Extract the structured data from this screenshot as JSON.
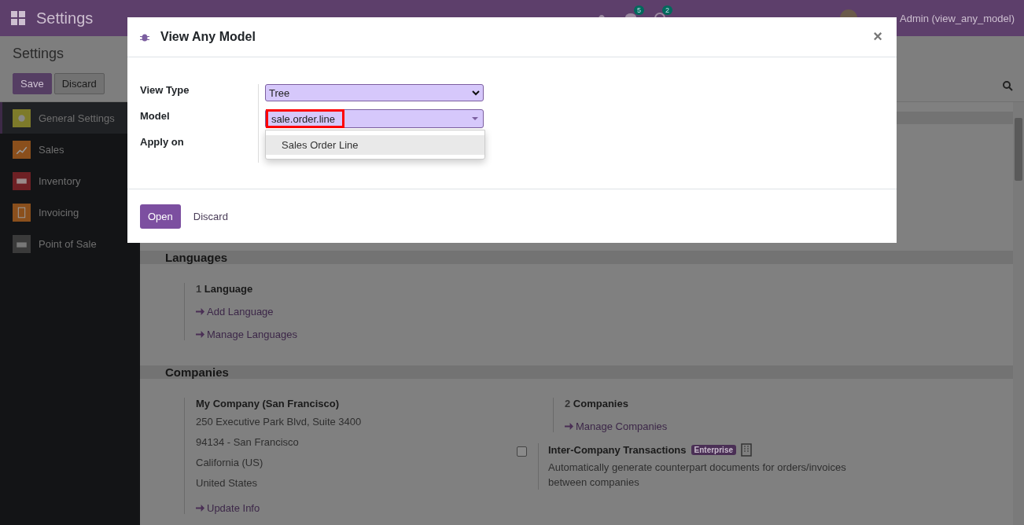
{
  "navbar": {
    "app_title": "Settings",
    "messages_count": "5",
    "activities_count": "2",
    "user": "Admin (view_any_model)"
  },
  "control_panel": {
    "title": "Settings",
    "buttons": [
      {
        "label": "Save",
        "kind": "primary"
      },
      {
        "label": "Discard",
        "kind": "secondary"
      }
    ]
  },
  "sidebar": {
    "items": [
      {
        "label": "General Settings",
        "selected": true,
        "color": "#7d7a2a"
      },
      {
        "label": "Sales",
        "selected": false,
        "color": "#8a4f1c"
      },
      {
        "label": "Inventory",
        "selected": false,
        "color": "#6e2024"
      },
      {
        "label": "Invoicing",
        "selected": false,
        "color": "#8a4f1c"
      },
      {
        "label": "Point of Sale",
        "selected": false,
        "color": "#3a3a3a"
      }
    ]
  },
  "sections": [
    {
      "title": "Languages",
      "left": {
        "heading_count": "1",
        "heading": "Language",
        "links": [
          "Add Language",
          "Manage Languages"
        ]
      }
    },
    {
      "title": "Companies",
      "left": {
        "heading": "My Company (San Francisco)",
        "lines": [
          "250 Executive Park Blvd, Suite 3400",
          "94134 - San Francisco",
          "California (US)",
          "United States"
        ],
        "links": [
          "Update Info"
        ]
      },
      "right": {
        "heading_count": "2",
        "heading": "Companies",
        "links": [
          "Manage Companies"
        ],
        "setting": {
          "label": "Inter-Company Transactions",
          "badge": "Enterprise",
          "checked": false,
          "description": "Automatically generate counterpart documents for orders/invoices between companies"
        }
      }
    }
  ],
  "dialog": {
    "title": "View Any Model",
    "close": "×",
    "fields": [
      {
        "label": "View Type",
        "kind": "select",
        "value": "Tree"
      },
      {
        "label": "Model",
        "kind": "autocomplete",
        "value": "sale.order.line",
        "highlighted": true
      },
      {
        "label": "Apply on",
        "kind": "empty"
      }
    ],
    "suggestions": [
      {
        "label": "Sales Order Line",
        "selected": true
      }
    ],
    "buttons": [
      {
        "label": "Open",
        "kind": "primary"
      },
      {
        "label": "Discard",
        "kind": "link"
      }
    ]
  }
}
